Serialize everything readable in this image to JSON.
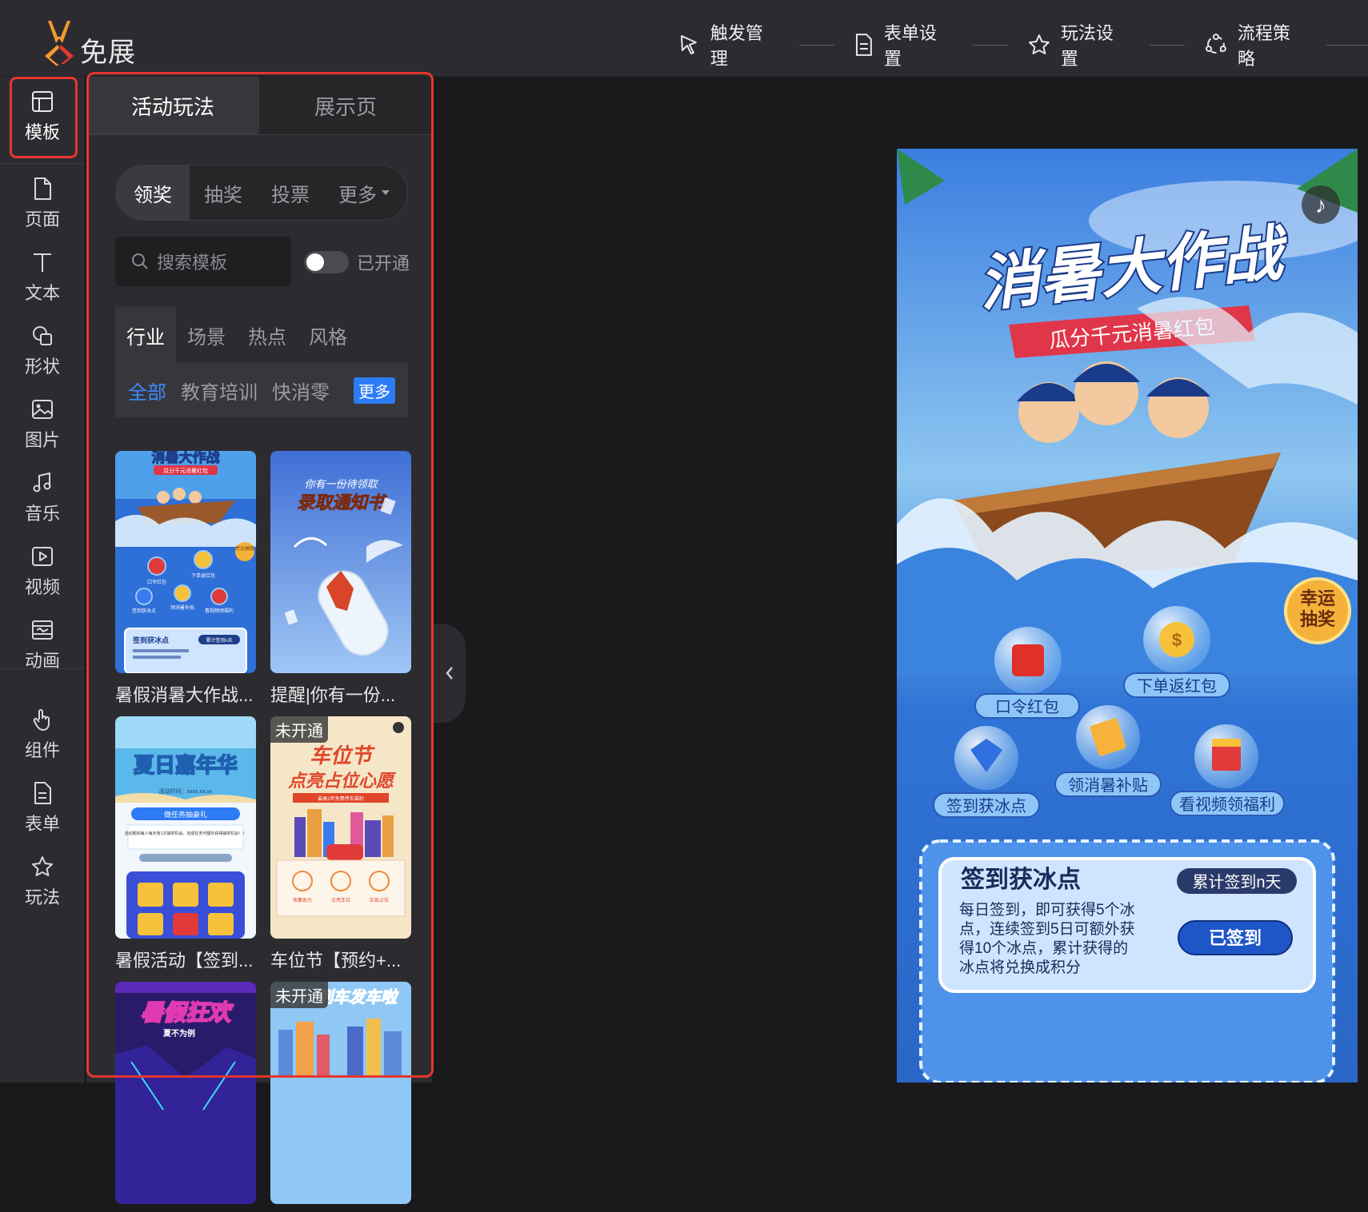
{
  "app": {
    "logo_text": "免展"
  },
  "steps": [
    {
      "label": "触发管理",
      "icon": "cursor-click-icon"
    },
    {
      "label": "表单设置",
      "icon": "document-icon"
    },
    {
      "label": "玩法设置",
      "icon": "star-icon"
    },
    {
      "label": "流程策略",
      "icon": "flow-icon"
    }
  ],
  "rail": [
    {
      "label": "模板",
      "icon": "layout-icon",
      "active": true
    },
    {
      "label": "页面",
      "icon": "page-icon"
    },
    {
      "label": "文本",
      "icon": "text-icon"
    },
    {
      "label": "形状",
      "icon": "shape-icon"
    },
    {
      "label": "图片",
      "icon": "image-icon"
    },
    {
      "label": "音乐",
      "icon": "music-icon"
    },
    {
      "label": "视频",
      "icon": "video-icon"
    },
    {
      "label": "动画",
      "icon": "animation-icon"
    },
    {
      "label": "组件",
      "icon": "hand-pointer-icon"
    },
    {
      "label": "表单",
      "icon": "form-icon"
    },
    {
      "label": "玩法",
      "icon": "star-icon"
    }
  ],
  "panel": {
    "tabs": [
      "活动玩法",
      "展示页"
    ],
    "segments": [
      "领奖",
      "抽奖",
      "投票",
      "更多"
    ],
    "search_placeholder": "搜索模板",
    "toggle_label": "已开通",
    "category_tabs": [
      "行业",
      "场景",
      "热点",
      "风格"
    ],
    "sub_categories": [
      "全部",
      "教育培训",
      "快消零"
    ],
    "sub_more": "更多",
    "cards": [
      {
        "title": "暑假消暑大作战...",
        "badge": ""
      },
      {
        "title": "提醒|你有一份...",
        "badge": ""
      },
      {
        "title": "暑假活动【签到...",
        "badge": ""
      },
      {
        "title": "车位节【预约+...",
        "badge": "未开通"
      },
      {
        "title": "",
        "badge": ""
      },
      {
        "title": "",
        "badge": "未开通"
      }
    ],
    "thumb_texts": {
      "t1_title": "消暑大作战",
      "t1_sub": "瓜分千元消暑红包",
      "t1_lucky": "幸运抽奖",
      "t1_items": [
        "口令红包",
        "下单返红包",
        "签到获冰点",
        "领消暑补贴",
        "看视频领福利"
      ],
      "t1_card": "签到获冰点",
      "t1_card_badge": "累计签到n天",
      "t2_top": "你有一份待领取",
      "t2_title": "录取通知书",
      "t3_title": "夏日嘉年华",
      "t3_sub": "活动时间：xxxx.xx.xx",
      "t3_btn": "做任务抽豪礼",
      "t3_desc": "活动期间每人每天有1次抽奖机会，完成任务可额外获得抽奖机会！！",
      "t4_title": "车位节",
      "t4_sub": "点亮占位心愿",
      "t4_ribbon": "最高1年免费停车福利",
      "t4_steps": [
        "收集助力",
        "点亮车位",
        "实现占位"
      ],
      "t5_title": "暑假狂欢",
      "t5_sub": "夏不为例",
      "t6_title": "列车发车啦"
    }
  },
  "preview": {
    "title": "消暑大作战",
    "subtitle": "瓜分千元消暑红包",
    "lucky": "幸运抽奖",
    "items": [
      "口令红包",
      "下单返红包",
      "签到获冰点",
      "领消暑补贴",
      "看视频领福利"
    ],
    "card": {
      "title": "签到获冰点",
      "badge": "累计签到n天",
      "desc": "每日签到，即可获得5个冰点，连续签到5日可额外获得10个冰点，累计获得的冰点将兑换成积分",
      "button": "已签到"
    }
  }
}
